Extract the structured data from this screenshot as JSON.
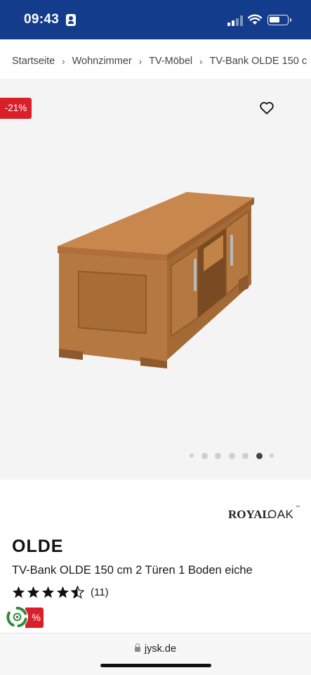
{
  "status_bar": {
    "time": "09:43",
    "background_color": "#143c8c",
    "icons": [
      "contact-card-icon",
      "cellular-signal-icon",
      "wifi-icon",
      "battery-icon"
    ]
  },
  "breadcrumb": {
    "items": [
      "Startseite",
      "Wohnzimmer",
      "TV-Möbel",
      "TV-Bank OLDE 150 c"
    ],
    "separator_icon": "chevron-right-icon"
  },
  "gallery": {
    "discount_badge": "-21%",
    "badge_color": "#d9202a",
    "wishlist_icon": "heart-outline-icon",
    "image": "tv-bench-oak-image",
    "image_count": 7,
    "active_index": 5
  },
  "product": {
    "brand": "ROYAL OAK",
    "brand_parts": [
      "ROYAL",
      "OAK"
    ],
    "title": "OLDE",
    "subtitle": "TV-Bank OLDE 150 cm 2 Türen 1 Boden eiche",
    "rating": 4.5,
    "rating_count": "(11)",
    "promo_badge": "%",
    "eco_icon": "sustainability-badge-icon"
  },
  "browser": {
    "url": "jysk.de",
    "lock_icon": "lock-icon"
  }
}
